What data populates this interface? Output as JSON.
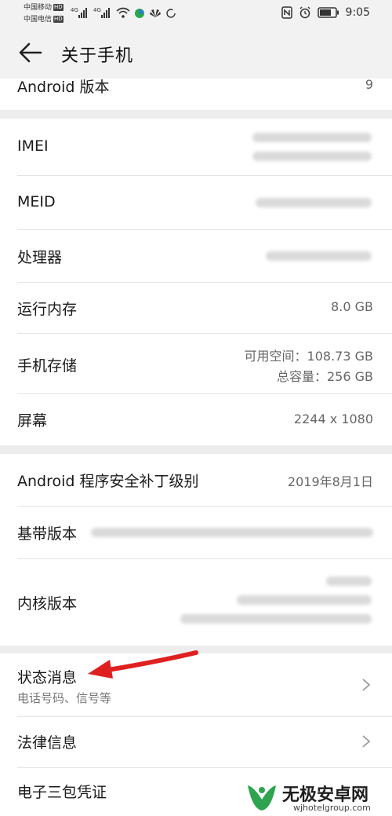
{
  "status_bar": {
    "carrier1": "中国移动",
    "carrier2": "中国电信",
    "hd_badge": "HD",
    "net1": "4G",
    "net2": "4G",
    "time": "9:05"
  },
  "header": {
    "title": "关于手机"
  },
  "android_version": {
    "label": "Android 版本",
    "value": "9"
  },
  "hardware": {
    "imei": {
      "label": "IMEI"
    },
    "meid": {
      "label": "MEID"
    },
    "processor": {
      "label": "处理器"
    },
    "ram": {
      "label": "运行内存",
      "value": "8.0 GB"
    },
    "storage": {
      "label": "手机存储",
      "available": "可用空间：108.73  GB",
      "total": "总容量：256  GB"
    },
    "screen": {
      "label": "屏幕",
      "value": "2244 x 1080"
    }
  },
  "software": {
    "security_patch": {
      "label": "Android 程序安全补丁级别",
      "value": "2019年8月1日"
    },
    "baseband": {
      "label": "基带版本"
    },
    "kernel": {
      "label": "内核版本"
    }
  },
  "menu": {
    "status": {
      "label": "状态消息",
      "sub": "电话号码、信号等"
    },
    "legal": {
      "label": "法律信息"
    },
    "warranty": {
      "label": "电子三包凭证"
    }
  },
  "watermark": {
    "name": "无极安卓网",
    "url": "wjhotelgroup.com"
  },
  "colors": {
    "background": "#ededed",
    "card": "#ffffff",
    "arrow": "#e02020",
    "watermark_green": "#2ea44f"
  }
}
